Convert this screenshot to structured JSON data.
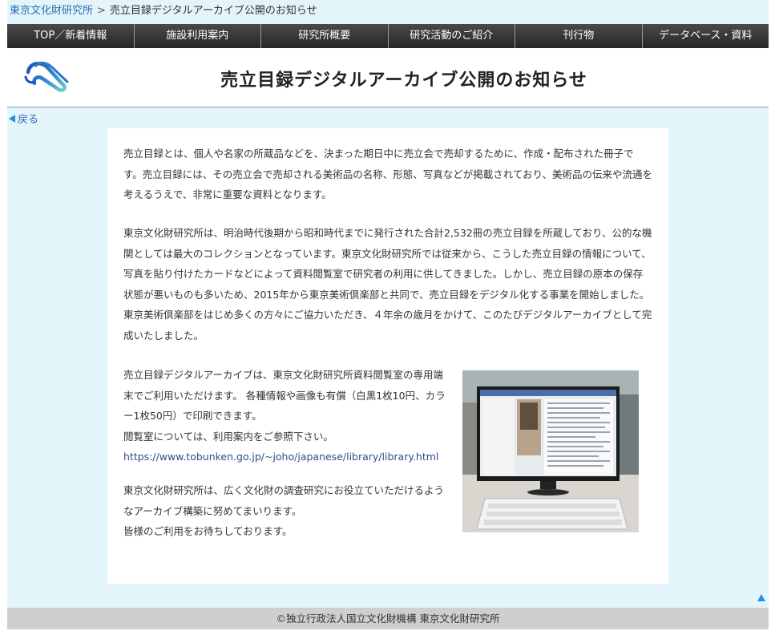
{
  "breadcrumb": {
    "home": "東京文化財研究所",
    "separator": ">",
    "current": "売立目録デジタルアーカイブ公開のお知らせ"
  },
  "nav": {
    "items": [
      "TOP／新着情報",
      "施設利用案内",
      "研究所概要",
      "研究活動のご紹介",
      "刊行物",
      "データベース・資料"
    ]
  },
  "header": {
    "title": "売立目録デジタルアーカイブ公開のお知らせ",
    "logo_icon": "tobunken-logo-icon"
  },
  "back_link": "戻る",
  "article": {
    "p1": "売立目録とは、個人や名家の所蔵品などを、決まった期日中に売立会で売却するために、作成・配布された冊子です。売立目録には、その売立会で売却される美術品の名称、形態、写真などが掲載されており、美術品の伝来や流通を考えるうえで、非常に重要な資料となります。",
    "p2": "東京文化財研究所は、明治時代後期から昭和時代までに発行された合計2,532冊の売立目録を所蔵しており、公的な機関としては最大のコレクションとなっています。東京文化財研究所では従来から、こうした売立目録の情報について、写真を貼り付けたカードなどによって資料閲覧室で研究者の利用に供してきました。しかし、売立目録の原本の保存状態が悪いものも多いため、2015年から東京美術倶楽部と共同で、売立目録をデジタル化する事業を開始しました。東京美術倶楽部をはじめ多くの方々にご協力いただき、４年余の歳月をかけて、このたびデジタルアーカイブとして完成いたしました。",
    "p3_line1": "売立目録デジタルアーカイブは、東京文化財研究所資料閲覧室の専用端末でご利用いただけます。 各種情報や画像も有償（白黒1枚10円、カラー1枚50円）で印刷できます。",
    "p3_line2": "閲覧室については、利用案内をご参照下さい。",
    "p3_link": "https://www.tobunken.go.jp/~joho/japanese/library/library.html",
    "p4_line1": "東京文化財研究所は、広く文化財の調査研究にお役立ていただけるようなアーカイブ構築に努めてまいります。",
    "p4_line2": "皆様のご利用をお待ちしております。"
  },
  "footer": {
    "copyright": "©独立行政法人国立文化財機構 東京文化財研究所"
  },
  "colors": {
    "page_bg": "#e3f4fb",
    "nav_bg": "#333333",
    "link": "#2a6db0",
    "footer_bg": "#cfcfcf"
  }
}
